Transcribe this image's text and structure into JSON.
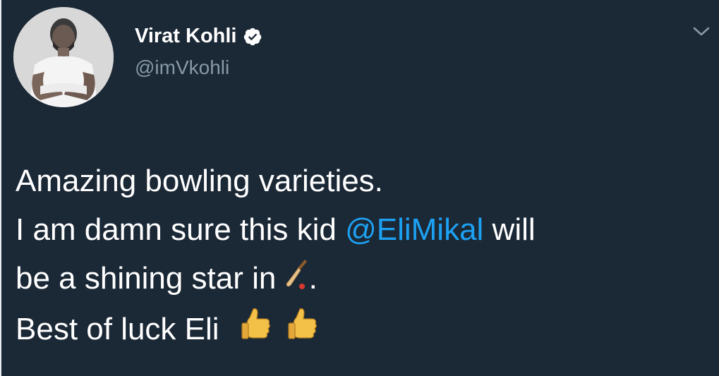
{
  "tweet": {
    "author": {
      "name": "Virat Kohli",
      "handle": "@imVkohli",
      "verified": true
    },
    "text": {
      "line1": "Amazing bowling varieties.",
      "line2_before": "I am damn sure this kid ",
      "line2_mention": "@EliMikal",
      "line2_after": " will",
      "line3_before": "be a shining star in ",
      "line3_after": ".",
      "line4": "Best of luck Eli"
    },
    "emojis": [
      "cricket-bat-icon",
      "thumbs-up-icon",
      "thumbs-up-icon"
    ],
    "colors": {
      "background": "#1b2836",
      "mention": "#1da1f2",
      "handle": "#8899a6",
      "verified": "#ffffff"
    }
  }
}
